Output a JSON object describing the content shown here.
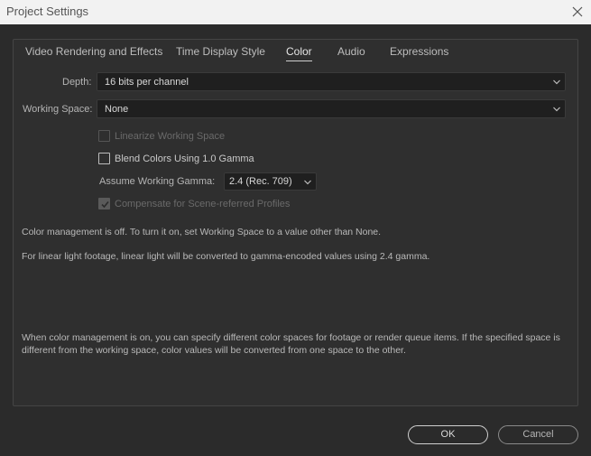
{
  "window": {
    "title": "Project Settings",
    "close_icon": "close-icon"
  },
  "tabs": [
    {
      "label": "Video Rendering and Effects",
      "active": false
    },
    {
      "label": "Time Display Style",
      "active": false
    },
    {
      "label": "Color",
      "active": true
    },
    {
      "label": "Audio",
      "active": false
    },
    {
      "label": "Expressions",
      "active": false
    }
  ],
  "color": {
    "depth": {
      "label": "Depth:",
      "value": "16 bits per channel"
    },
    "working_space": {
      "label": "Working Space:",
      "value": "None"
    },
    "linearize": {
      "label": "Linearize Working Space",
      "checked": false,
      "enabled": false
    },
    "blend": {
      "label": "Blend Colors Using 1.0 Gamma",
      "checked": false,
      "enabled": true
    },
    "gamma": {
      "label": "Assume Working Gamma:",
      "value": "2.4 (Rec. 709)"
    },
    "compensate": {
      "label": "Compensate for Scene-referred Profiles",
      "checked": true,
      "enabled": false
    },
    "notes": {
      "off": "Color management is off. To turn it on, set Working Space to a value other than None.",
      "linear": "For linear light footage, linear light will be converted to gamma-encoded values using 2.4 gamma.",
      "on": "When color management is on, you can specify different color spaces for footage or render queue items. If the specified space is different from the working space, color values will be converted from one space to the other."
    }
  },
  "buttons": {
    "ok": "OK",
    "cancel": "Cancel"
  },
  "colors": {
    "background": "#2b2b2b",
    "titlebar": "#f2f2f2",
    "field": "#1f1f1f"
  }
}
